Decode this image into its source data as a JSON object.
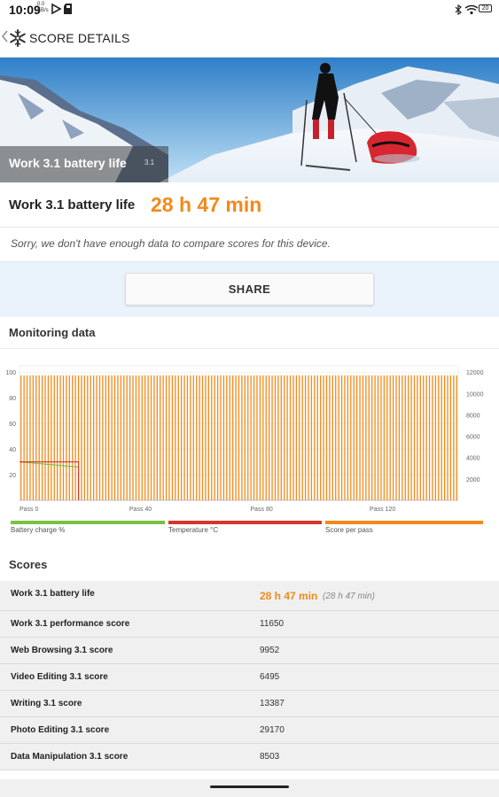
{
  "status_bar": {
    "time": "10:09",
    "net_speed_value": "0.0",
    "net_speed_unit": "KB/s",
    "battery_level": "20",
    "icons": [
      "youtube-icon",
      "play-icon",
      "sd-card-icon",
      "bluetooth-icon",
      "wifi-icon",
      "battery-icon"
    ]
  },
  "header": {
    "title": "SCORE DETAILS",
    "back_icon": "chevron-left-icon",
    "logo_icon": "snowflake-icon"
  },
  "hero": {
    "title": "Work 3.1 battery life",
    "version": "3.1"
  },
  "score": {
    "label": "Work 3.1 battery life",
    "value": "28 h 47 min"
  },
  "note": "Sorry, we don't have enough data to compare scores for this device.",
  "share_label": "SHARE",
  "monitoring": {
    "title": "Monitoring data"
  },
  "chart_data": {
    "type": "line",
    "x_tick_labels": [
      "Pass 0",
      "Pass 40",
      "Pass 80",
      "Pass 120"
    ],
    "y_left_ticks": [
      100,
      80,
      60,
      40,
      20
    ],
    "y_right_ticks": [
      12000,
      10000,
      8000,
      6000,
      4000,
      2000
    ],
    "y_left_range": [
      0,
      105
    ],
    "y_right_range": [
      0,
      12600
    ],
    "passes": 145,
    "series": [
      {
        "name": "Battery charge %",
        "color": "#7ac143",
        "axis": "left",
        "points": [
          [
            0,
            30
          ],
          [
            19.5,
            26
          ],
          [
            19.5,
            0
          ]
        ]
      },
      {
        "name": "Temperature °C",
        "color": "#d9342b",
        "axis": "left",
        "points": [
          [
            0,
            30
          ],
          [
            19.5,
            30
          ],
          [
            19.5,
            0
          ]
        ]
      },
      {
        "name": "Score per pass",
        "color": "#f28a1b",
        "axis": "right",
        "style": "bars",
        "typical_value": 11700
      }
    ],
    "grid": true
  },
  "legend": [
    {
      "label": "Battery charge %",
      "color": "#7ac143"
    },
    {
      "label": "Temperature °C",
      "color": "#d9342b"
    },
    {
      "label": "Score per pass",
      "color": "#f28a1b"
    }
  ],
  "scores": {
    "title": "Scores",
    "rows": [
      {
        "name": "Work 3.1 battery life",
        "value": "28 h 47 min",
        "sub": "(28 h 47 min)"
      },
      {
        "name": "Work 3.1 performance score",
        "value": "11650"
      },
      {
        "name": "Web Browsing 3.1 score",
        "value": "9952"
      },
      {
        "name": "Video Editing 3.1 score",
        "value": "6495"
      },
      {
        "name": "Writing 3.1 score",
        "value": "13387"
      },
      {
        "name": "Photo Editing 3.1 score",
        "value": "29170"
      },
      {
        "name": "Data Manipulation 3.1 score",
        "value": "8503"
      }
    ]
  },
  "colors": {
    "accent": "#f28a1b",
    "share_band": "#eaf3fb"
  }
}
